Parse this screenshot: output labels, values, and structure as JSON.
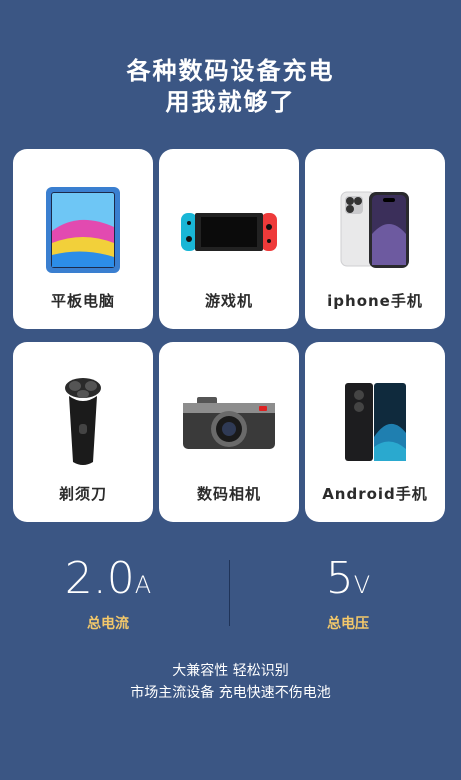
{
  "headline": {
    "line1": "各种数码设备充电",
    "line2": "用我就够了"
  },
  "devices": [
    {
      "label": "平板电脑",
      "icon": "tablet-icon"
    },
    {
      "label": "游戏机",
      "icon": "game-console-icon"
    },
    {
      "label": "iphone手机",
      "icon": "iphone-icon"
    },
    {
      "label": "剃须刀",
      "icon": "shaver-icon"
    },
    {
      "label": "数码相机",
      "icon": "camera-icon"
    },
    {
      "label": "Android手机",
      "icon": "android-phone-icon"
    }
  ],
  "stats": {
    "current": {
      "value": "2.0",
      "unit": "A",
      "caption": "总电流"
    },
    "voltage": {
      "value": "5",
      "unit": "V",
      "caption": "总电压"
    }
  },
  "footer": {
    "line1": "大兼容性 轻松识别",
    "line2": "市场主流设备 充电快速不伤电池"
  },
  "colors": {
    "background": "#3b5684",
    "accent": "#f3c86a",
    "card": "#ffffff"
  }
}
